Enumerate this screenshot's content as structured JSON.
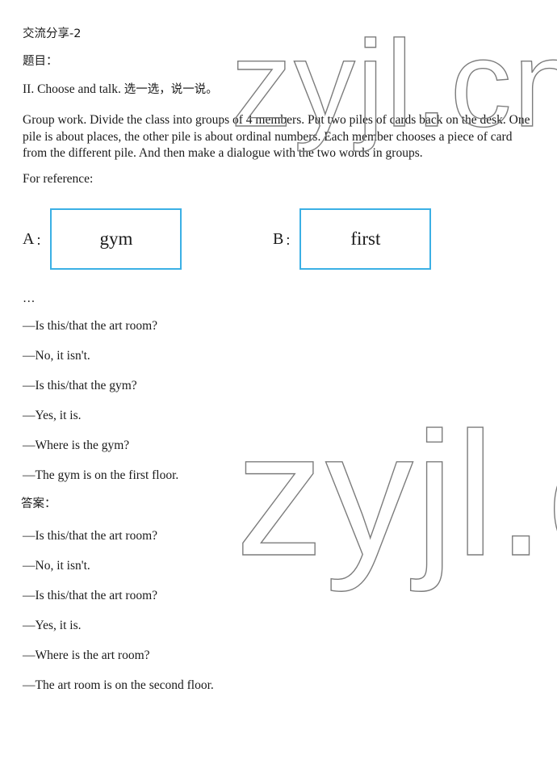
{
  "document": {
    "title": "交流分享-2",
    "prompt_label": "题目：",
    "instruction_en": "II. Choose and talk. ",
    "instruction_zh": "选一选，说一说。",
    "paragraph": "Group work. Divide the class into groups of 4 members. Put two piles of cards back on the desk. One pile is about places, the other pile is about ordinal numbers. Each member chooses a piece of card from the different pile. And then make a dialogue with the two words in groups.",
    "for_reference": "For reference:",
    "answer_label": "答案："
  },
  "cards": [
    {
      "letter": "A",
      "colon": "：",
      "word": "gym"
    },
    {
      "letter": "B",
      "colon": "：",
      "word": "first"
    }
  ],
  "reference_dialogue": [
    "…",
    "—Is this/that the art room?",
    "—No, it isn't.",
    "—Is this/that the gym?",
    "—Yes, it is.",
    "—Where is the gym?",
    "—The gym is on the first floor."
  ],
  "answer_dialogue": [
    "—Is this/that the art room?",
    "—No, it isn't.",
    "—Is this/that the art room?",
    "—Yes, it is.",
    "—Where is the art room?",
    "—The art room is on the second floor."
  ],
  "watermark": {
    "top_text": "zyjl.cn",
    "bottom_text": "zyjl.c",
    "color": "#7c7c7c"
  },
  "colors": {
    "card_border": "#3bb0e5",
    "text": "#1a1a1a",
    "background": "#ffffff"
  }
}
